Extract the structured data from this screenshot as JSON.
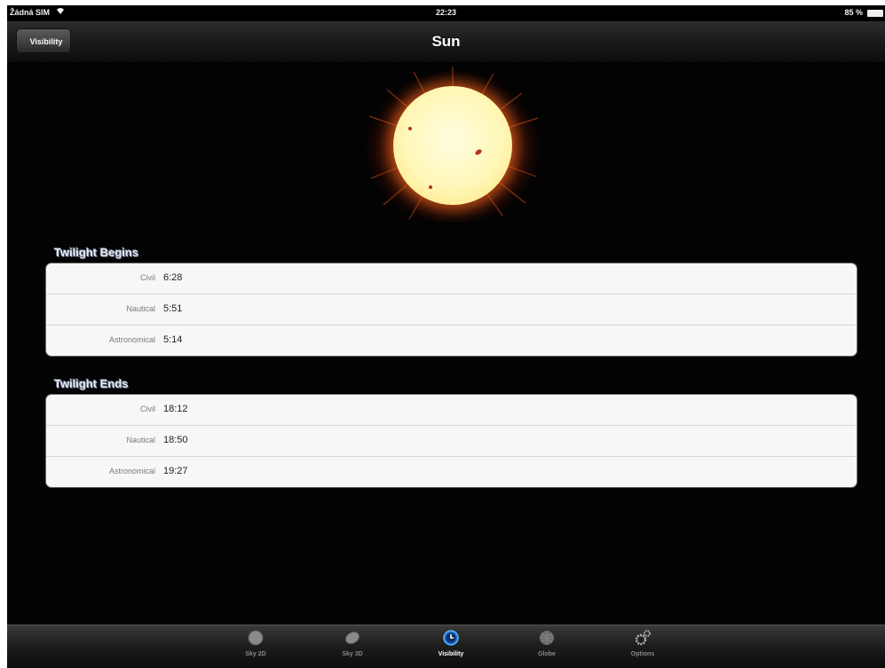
{
  "status_bar": {
    "carrier": "Žádná SIM",
    "time": "22:23",
    "battery": "85 %"
  },
  "nav": {
    "back_label": "Visibility",
    "title": "Sun"
  },
  "twilight_begins": {
    "header": "Twilight Begins",
    "rows": [
      {
        "label": "Civil",
        "value": "6:28"
      },
      {
        "label": "Nautical",
        "value": "5:51"
      },
      {
        "label": "Astronomical",
        "value": "5:14"
      }
    ]
  },
  "twilight_ends": {
    "header": "Twilight Ends",
    "rows": [
      {
        "label": "Civil",
        "value": "18:12"
      },
      {
        "label": "Nautical",
        "value": "18:50"
      },
      {
        "label": "Astronomical",
        "value": "19:27"
      }
    ]
  },
  "tabbar": {
    "tabs": [
      {
        "label": "Sky 2D",
        "icon": "sky-2d-icon"
      },
      {
        "label": "Sky 3D",
        "icon": "sky-3d-icon"
      },
      {
        "label": "Visibility",
        "icon": "clock-icon",
        "active": true
      },
      {
        "label": "Globe",
        "icon": "globe-icon"
      },
      {
        "label": "Options",
        "icon": "gears-icon"
      }
    ]
  },
  "colors": {
    "accent": "#2f8fe8",
    "background": "#030303",
    "sun": "#fff7b8",
    "corona": "#e8551e"
  }
}
